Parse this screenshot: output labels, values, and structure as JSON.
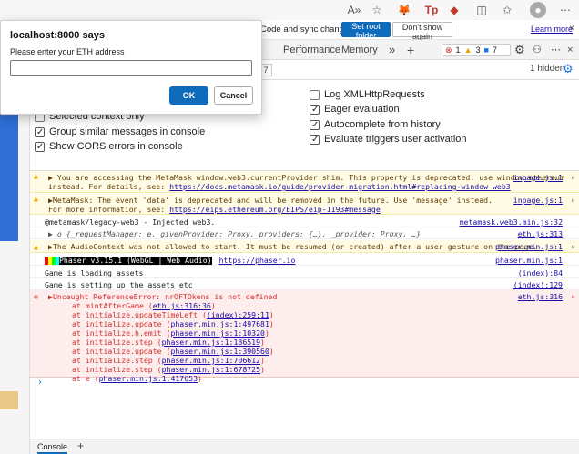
{
  "browser": {
    "tp_label": "Tp"
  },
  "banner": {
    "text": "Code and sync changes.",
    "set_root": "Set root folder",
    "dont_show": "Don't show again",
    "learn_more": "Learn more"
  },
  "tabs": {
    "partial": "k",
    "performance": "Performance",
    "memory": "Memory",
    "more": "»",
    "add": "+",
    "err_count": "1",
    "warn_count": "3",
    "info_count": "7"
  },
  "filter": {
    "partial": "7",
    "hidden": "1 hidden"
  },
  "settings": {
    "right": [
      {
        "label": "Log XMLHttpRequests",
        "checked": false
      },
      {
        "label": "Eager evaluation",
        "checked": true
      },
      {
        "label": "Autocomplete from history",
        "checked": true
      },
      {
        "label": "Evaluate triggers user activation",
        "checked": true
      }
    ],
    "left": [
      {
        "label": "Selected context only",
        "checked": false
      },
      {
        "label": "Group similar messages in console",
        "checked": true
      },
      {
        "label": "Show CORS errors in console",
        "checked": true
      }
    ]
  },
  "console": {
    "m1_line1": "You are accessing the MetaMask window.web3.currentProvider shim. This property is deprecated; use window.ethereum",
    "m1_line2": "instead. For details, see: ",
    "m1_link": "https://docs.metamask.io/guide/provider-migration.html#replacing-window-web3",
    "m1_src": "inpage.js:1",
    "m2_line1": "MetaMask: The event 'data' is deprecated and will be removed in the future. Use 'message' instead.",
    "m2_line2": "For more information, see: ",
    "m2_link": "https://eips.ethereum.org/EIPS/eip-1193#message",
    "m2_src": "inpage.js:1",
    "m3_text": "@metamask/legacy-web3 - Injected web3.",
    "m3_src": "metamask.web3.min.js:32",
    "m4_text": "o {_requestManager: e, givenProvider: Proxy, providers: {…}, _provider: Proxy, …}",
    "m4_src": "eth.js:313",
    "m5_text": "The AudioContext was not allowed to start. It must be resumed (or created) after a user gesture on the page.",
    "m5_src": "phaser.min.js:1",
    "m6_banner": " Phaser v3.15.1 (WebGL | Web Audio) ",
    "m6_link": "https://phaser.io",
    "m6_src": "phaser.min.js:1",
    "m7_text": "Game is loading assets",
    "m7_src": "(index):84",
    "m8_text": "Game is setting up the assets etc",
    "m8_src": "(index):129",
    "err_title": "Uncaught ReferenceError: nrOFTOkens is not defined",
    "err_src": "eth.js:316",
    "stack": [
      {
        "prefix": "at mintAfterGame (",
        "link": "eth.js:316:36",
        "suffix": ")"
      },
      {
        "prefix": "at initialize.updateTimeLeft (",
        "link": "(index):259:11",
        "suffix": ")"
      },
      {
        "prefix": "at initialize.update (",
        "link": "phaser.min.js:1:497681",
        "suffix": ")"
      },
      {
        "prefix": "at initialize.h.emit (",
        "link": "phaser.min.js:1:10320",
        "suffix": ")"
      },
      {
        "prefix": "at initialize.step (",
        "link": "phaser.min.js:1:186519",
        "suffix": ")"
      },
      {
        "prefix": "at initialize.update (",
        "link": "phaser.min.js:1:390560",
        "suffix": ")"
      },
      {
        "prefix": "at initialize.step (",
        "link": "phaser.min.js:1:706612",
        "suffix": ")"
      },
      {
        "prefix": "at initialize.step (",
        "link": "phaser.min.js:1:678725",
        "suffix": ")"
      },
      {
        "prefix": "at e (",
        "link": "phaser.min.js:1:417653",
        "suffix": ")"
      }
    ],
    "prompt": "›"
  },
  "bottom": {
    "console_tab": "Console",
    "add": "+"
  },
  "dialog": {
    "title": "localhost:8000 says",
    "message": "Please enter your ETH address",
    "input_value": "",
    "ok": "OK",
    "cancel": "Cancel"
  },
  "colors": {
    "accent": "#0f6cbd",
    "warning_bg": "#fffbe5",
    "error_bg": "#fdeded",
    "error_text": "#d32f2f"
  }
}
